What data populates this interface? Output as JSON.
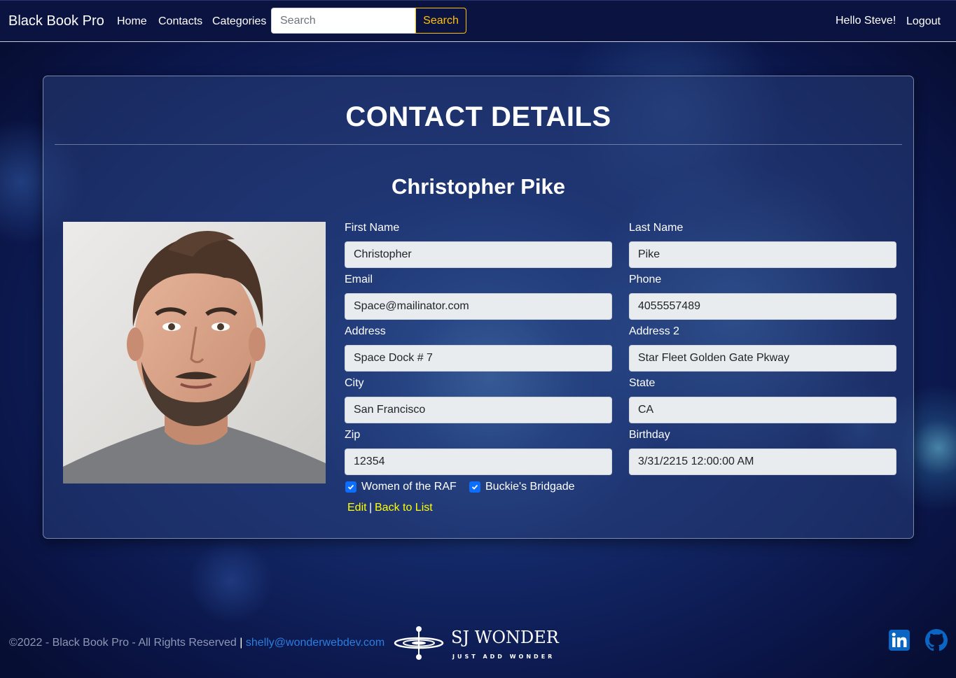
{
  "navbar": {
    "brand": "Black Book Pro",
    "links": [
      "Home",
      "Contacts",
      "Categories"
    ],
    "search_placeholder": "Search",
    "search_button": "Search",
    "greeting": "Hello Steve!",
    "logout": "Logout"
  },
  "card": {
    "title": "CONTACT DETAILS",
    "contact_name": "Christopher Pike"
  },
  "fields": {
    "first_name": {
      "label": "First Name",
      "value": "Christopher"
    },
    "last_name": {
      "label": "Last Name",
      "value": "Pike"
    },
    "email": {
      "label": "Email",
      "value": "Space@mailinator.com"
    },
    "phone": {
      "label": "Phone",
      "value": "4055557489"
    },
    "address": {
      "label": "Address",
      "value": "Space Dock # 7"
    },
    "address2": {
      "label": "Address 2",
      "value": "Star Fleet Golden Gate Pkway"
    },
    "city": {
      "label": "City",
      "value": "San Francisco"
    },
    "state": {
      "label": "State",
      "value": "CA"
    },
    "zip": {
      "label": "Zip",
      "value": "12354"
    },
    "birthday": {
      "label": "Birthday",
      "value": "3/31/2215 12:00:00 AM"
    }
  },
  "categories": [
    {
      "label": "Women of the RAF",
      "checked": true
    },
    {
      "label": "Buckie's Bridgade",
      "checked": true
    }
  ],
  "actions": {
    "edit": "Edit",
    "separator": "|",
    "back": "Back to List"
  },
  "footer": {
    "copyright": "©2022 - Black Book Pro - All Rights Reserved",
    "separator": "|",
    "email": "shelly@wonderwebdev.com",
    "logo_title": "SJ WONDER",
    "logo_tagline": "JUST ADD WONDER"
  },
  "icons": {
    "linkedin": "linkedin-icon",
    "github": "github-icon"
  },
  "colors": {
    "accent_yellow": "#ffff00",
    "search_border": "#ffc107",
    "checkbox": "#0d6efd",
    "footer_link": "#2b7de0",
    "social_icon": "#0a66c2"
  }
}
